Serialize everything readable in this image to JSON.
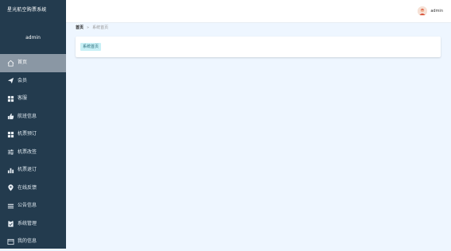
{
  "app": {
    "title": "星光航空购票系统"
  },
  "sidebar": {
    "username": "admin",
    "items": [
      {
        "label": "首页",
        "icon": "home-icon",
        "active": true
      },
      {
        "label": "会员",
        "icon": "paper-plane-icon"
      },
      {
        "label": "客服",
        "icon": "grid-icon"
      },
      {
        "label": "航班信息",
        "icon": "thumbs-up-icon"
      },
      {
        "label": "机票预订",
        "icon": "grid-icon"
      },
      {
        "label": "机票改签",
        "icon": "sliders-icon"
      },
      {
        "label": "机票退订",
        "icon": "bar-chart-icon"
      },
      {
        "label": "在线反馈",
        "icon": "location-pin-icon"
      },
      {
        "label": "公告信息",
        "icon": "list-icon"
      },
      {
        "label": "系统管理",
        "icon": "clipboard-icon"
      },
      {
        "label": "我的信息",
        "icon": "window-icon"
      }
    ]
  },
  "header": {
    "username": "admin"
  },
  "breadcrumb": {
    "home": "首页",
    "separator": "»",
    "current": "系统首页"
  },
  "main": {
    "tag": "系统首页"
  },
  "colors": {
    "sidebar_bg": "#233b4e",
    "active_item": "#8a97a4",
    "tag_bg": "#c8f0f6"
  }
}
